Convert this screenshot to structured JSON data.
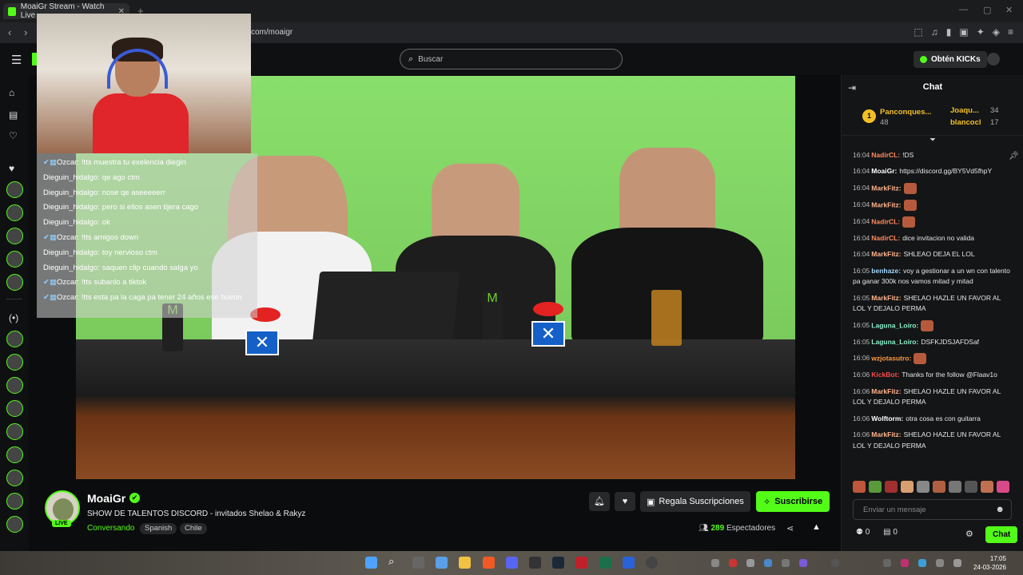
{
  "browser": {
    "tab_title": "MoaiGr Stream - Watch Live ...",
    "tab_close": "✕",
    "new_tab": "+",
    "url": "com/moaigr",
    "back": "‹",
    "forward": "›"
  },
  "header": {
    "search_placeholder": "Buscar",
    "get_kicks": "Obtén KICKs"
  },
  "overlay_chat": [
    {
      "user": "Ozcar:",
      "text": "!tts muestra tu exelencia diegin",
      "badge": "✔▦"
    },
    {
      "user": "Dieguin_hidalgo:",
      "text": "qe ago ctm",
      "badge": ""
    },
    {
      "user": "Dieguin_hidalgo:",
      "text": "nose qe aseeeeerr",
      "badge": ""
    },
    {
      "user": "Dieguin_hidalgo:",
      "text": "pero si ellos asen tijera cago",
      "badge": ""
    },
    {
      "user": "Dieguin_hidalgo:",
      "text": "ok",
      "badge": ""
    },
    {
      "user": "Ozcar:",
      "text": "!tts amigos down",
      "badge": "✔▦"
    },
    {
      "user": "Dieguin_hidalgo:",
      "text": "toy nervioso ctm",
      "badge": ""
    },
    {
      "user": "Dieguin_hidalgo:",
      "text": "saquen clip cuando salga yo",
      "badge": ""
    },
    {
      "user": "Ozcar:",
      "text": "!tts subanlo a tiktok",
      "badge": "✔▦"
    },
    {
      "user": "Ozcar:",
      "text": "!tts esta pa la caga pa tener 24 años ese hueon",
      "badge": "✔▦"
    }
  ],
  "channel": {
    "name": "MoaiGr",
    "live": "LIVE",
    "title": "SHOW DE TALENTOS DISCORD - invitados Shelao & Rakyz",
    "category": "Conversando",
    "tags": [
      "Spanish",
      "Chile"
    ],
    "gift_label": "Regala Suscripciones",
    "subscribe_label": "Suscribirse",
    "viewers": "289",
    "viewers_label": "Espectadores"
  },
  "chat": {
    "title": "Chat",
    "gifters": [
      {
        "rank": "1",
        "name": "Panconques...",
        "count": "48"
      },
      {
        "name": "Joaqu...",
        "count": "34"
      },
      {
        "name": "blancocl",
        "count": "17"
      }
    ],
    "messages": [
      {
        "time": "16:04",
        "user": "NadirCL:",
        "color": "#ff8a5c",
        "text": "!DS"
      },
      {
        "time": "16:04",
        "user": "MoaiGr:",
        "color": "#ffffff",
        "text": "https://discord.gg/BY5Vd5fhpY"
      },
      {
        "time": "16:04",
        "user": "MarkFitz:",
        "color": "#ffb38a",
        "text": "",
        "emote": true
      },
      {
        "time": "16:04",
        "user": "MarkFitz:",
        "color": "#ffb38a",
        "text": "",
        "emote": true
      },
      {
        "time": "16:04",
        "user": "NadirCL:",
        "color": "#ff8a5c",
        "text": "",
        "emote": true
      },
      {
        "time": "16:04",
        "user": "NadirCL:",
        "color": "#ff8a5c",
        "text": "dice invitacion no valida"
      },
      {
        "time": "16:04",
        "user": "MarkFitz:",
        "color": "#ffb38a",
        "text": "SHLEAO DEJA EL LOL"
      },
      {
        "time": "16:05",
        "user": "benhaze:",
        "color": "#9fd8ff",
        "text": "voy a gestionar a un wn con talento pa ganar 300k nos vamos mitad y mitad"
      },
      {
        "time": "16:05",
        "user": "MarkFitz:",
        "color": "#ffb38a",
        "text": "SHELAO HAZLE UN FAVOR AL LOL Y DEJALO PERMA"
      },
      {
        "time": "16:05",
        "user": "Laguna_Loiro:",
        "color": "#8af0c8",
        "text": "",
        "emote": true
      },
      {
        "time": "16:05",
        "user": "Laguna_Loiro:",
        "color": "#8af0c8",
        "text": "DSFKJDSJAFDSaf"
      },
      {
        "time": "16:06",
        "user": "wzjotasutro:",
        "color": "#ff9a3c",
        "text": "",
        "emote": true
      },
      {
        "time": "16:06",
        "user": "KickBot:",
        "color": "#ff4a4a",
        "text": "Thanks for the follow @Flaav1o"
      },
      {
        "time": "16:06",
        "user": "MarkFitz:",
        "color": "#ffb38a",
        "text": "SHELAO HAZLE UN FAVOR AL LOL Y DEJALO PERMA"
      },
      {
        "time": "16:06",
        "user": "Wolftorm:",
        "color": "#ffffff",
        "text": "otra cosa es con guitarra"
      },
      {
        "time": "16:06",
        "user": "MarkFitz:",
        "color": "#ffb38a",
        "text": "SHELAO HAZLE UN FAVOR AL LOL Y DEJALO PERMA"
      }
    ],
    "input_placeholder": "Enviar un mensaje",
    "kicks_count": "0",
    "points_count": "0",
    "send_label": "Chat"
  },
  "taskbar": {
    "time": "17:05",
    "date": "24-03-2026"
  },
  "colors": {
    "kick_green": "#53fc18",
    "bg": "#0b0c0d"
  }
}
